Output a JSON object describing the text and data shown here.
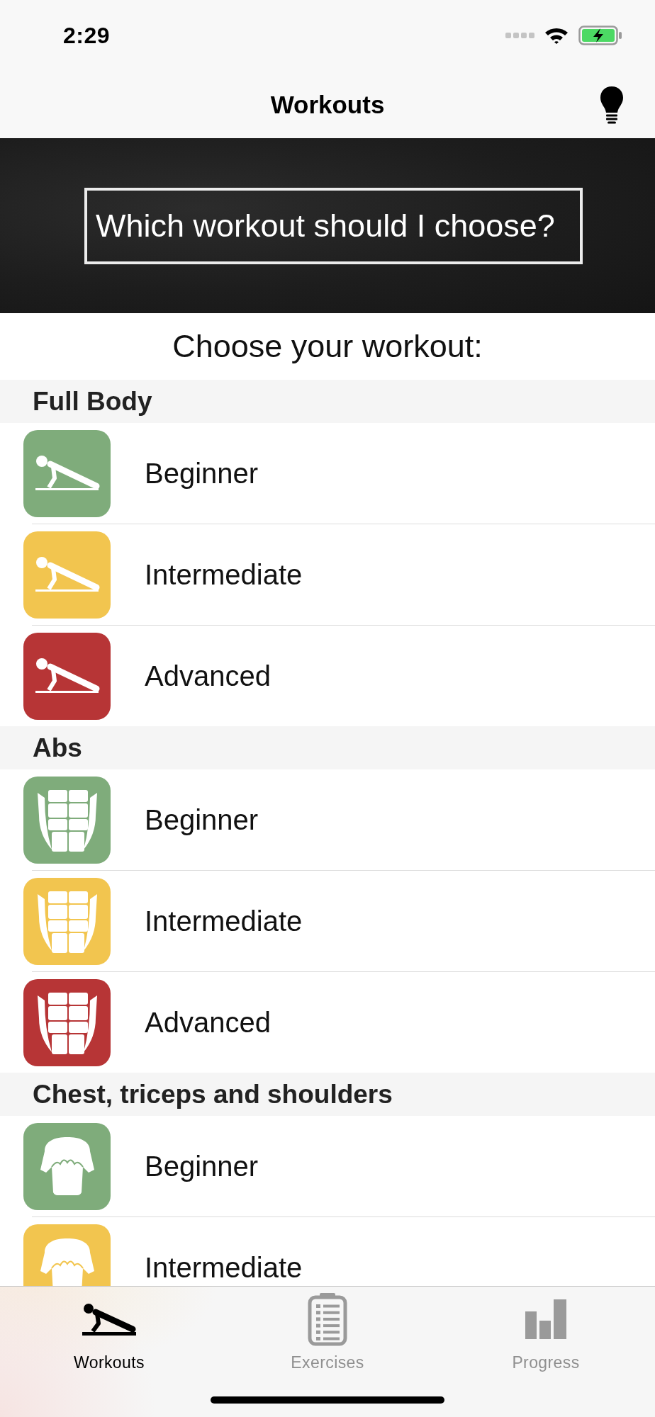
{
  "status_bar": {
    "time": "2:29"
  },
  "nav_bar": {
    "title": "Workouts"
  },
  "banner": {
    "text": "Which workout should I choose?"
  },
  "heading": "Choose your workout:",
  "sections": [
    {
      "title": "Full Body",
      "kind": "pushup",
      "rows": [
        {
          "label": "Beginner",
          "color": "#7fac7b"
        },
        {
          "label": "Intermediate",
          "color": "#f2c54f"
        },
        {
          "label": "Advanced",
          "color": "#b73536"
        }
      ]
    },
    {
      "title": "Abs",
      "kind": "abs",
      "rows": [
        {
          "label": "Beginner",
          "color": "#7fac7b"
        },
        {
          "label": "Intermediate",
          "color": "#f2c54f"
        },
        {
          "label": "Advanced",
          "color": "#b73536"
        }
      ]
    },
    {
      "title": "Chest, triceps and shoulders",
      "kind": "chest",
      "rows": [
        {
          "label": "Beginner",
          "color": "#7fac7b"
        },
        {
          "label": "Intermediate",
          "color": "#f2c54f"
        }
      ]
    }
  ],
  "tab_bar": {
    "tabs": [
      {
        "label": "Workouts",
        "kind": "pushup",
        "selected": true
      },
      {
        "label": "Exercises",
        "kind": "clipboard",
        "selected": false
      },
      {
        "label": "Progress",
        "kind": "chart",
        "selected": false
      }
    ]
  }
}
